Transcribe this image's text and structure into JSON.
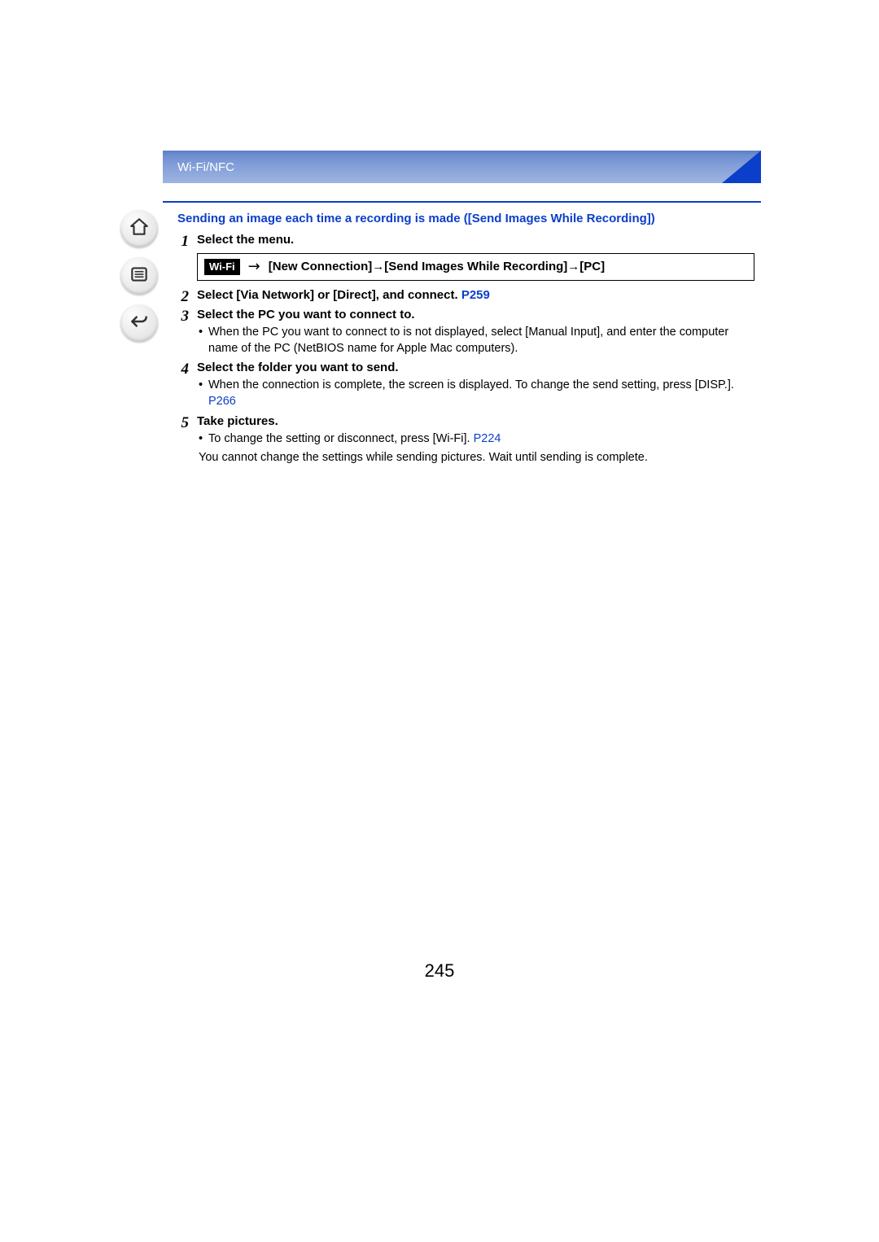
{
  "header": {
    "breadcrumb": "Wi-Fi/NFC"
  },
  "section": {
    "title": "Sending an image each time a recording is made ([Send Images While Recording])"
  },
  "menu_path": {
    "chip": "Wi-Fi",
    "arrow": "→",
    "path": "[New Connection]→[Send Images While Recording]→[PC]"
  },
  "steps": {
    "s1": {
      "num": "1",
      "title": "Select the menu."
    },
    "s2": {
      "num": "2",
      "title_a": "Select [Via Network] or [Direct], and connect. ",
      "link": "P259"
    },
    "s3": {
      "num": "3",
      "title": "Select the PC you want to connect to.",
      "note": "When the PC you want to connect to is not displayed, select [Manual Input], and enter the computer name of the PC (NetBIOS name for Apple Mac computers)."
    },
    "s4": {
      "num": "4",
      "title": "Select the folder you want to send.",
      "note_a": "When the connection is complete, the screen is displayed. To change the send setting, press [DISP.]. ",
      "note_link": "P266"
    },
    "s5": {
      "num": "5",
      "title": "Take pictures.",
      "note1_a": "To change the setting or disconnect, press [Wi-Fi]. ",
      "note1_link": "P224",
      "note2": "You cannot change the settings while sending pictures. Wait until sending is complete."
    }
  },
  "page_number": "245"
}
